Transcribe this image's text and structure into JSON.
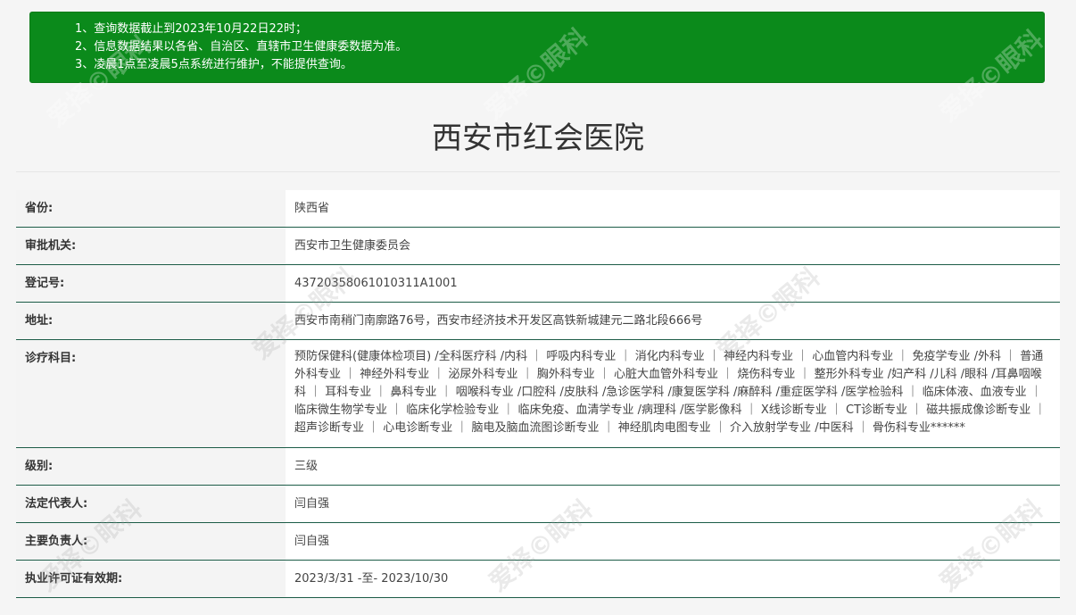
{
  "notice": {
    "lines": [
      "1、查询数据截止到2023年10月22日22时；",
      "2、信息数据结果以各省、自治区、直辖市卫生健康委数据为准。",
      "3、凌晨1点至凌晨5点系统进行维护，不能提供查询。"
    ]
  },
  "hospital": {
    "name": "西安市红会医院"
  },
  "details": [
    {
      "label": "省份:",
      "value": "陕西省"
    },
    {
      "label": "审批机关:",
      "value": "西安市卫生健康委员会"
    },
    {
      "label": "登记号:",
      "value": "43720358061010311A1001"
    },
    {
      "label": "地址:",
      "value": "西安市南稍门南廓路76号，西安市经济技术开发区高铁新城建元二路北段666号"
    },
    {
      "label": "诊疗科目:",
      "value": "预防保健科(健康体检项目) /全科医疗科 /内科 ｜ 呼吸内科专业 ｜ 消化内科专业 ｜ 神经内科专业 ｜ 心血管内科专业 ｜ 免疫学专业 /外科 ｜ 普通外科专业 ｜ 神经外科专业 ｜ 泌尿外科专业 ｜ 胸外科专业 ｜ 心脏大血管外科专业 ｜ 烧伤科专业 ｜ 整形外科专业 /妇产科 /儿科 /眼科 /耳鼻咽喉科 ｜ 耳科专业 ｜ 鼻科专业 ｜ 咽喉科专业 /口腔科 /皮肤科 /急诊医学科 /康复医学科 /麻醉科 /重症医学科 /医学检验科 ｜ 临床体液、血液专业 ｜ 临床微生物学专业 ｜ 临床化学检验专业 ｜ 临床免疫、血清学专业 /病理科 /医学影像科 ｜ X线诊断专业 ｜ CT诊断专业 ｜ 磁共振成像诊断专业 ｜ 超声诊断专业 ｜ 心电诊断专业 ｜ 脑电及脑血流图诊断专业 ｜ 神经肌肉电图专业 ｜ 介入放射学专业 /中医科 ｜ 骨伤科专业******"
    },
    {
      "label": "级别:",
      "value": "三级"
    },
    {
      "label": "法定代表人:",
      "value": "闫自强"
    },
    {
      "label": "主要负责人:",
      "value": "闫自强"
    },
    {
      "label": "执业许可证有效期:",
      "value": "2023/3/31 -至- 2023/10/30"
    }
  ],
  "watermark_text": "爱择©眼科",
  "colors": {
    "notice_bg": "#0b8a1b",
    "row_border": "#1c5c47",
    "label_bg": "#f4f4f4"
  }
}
